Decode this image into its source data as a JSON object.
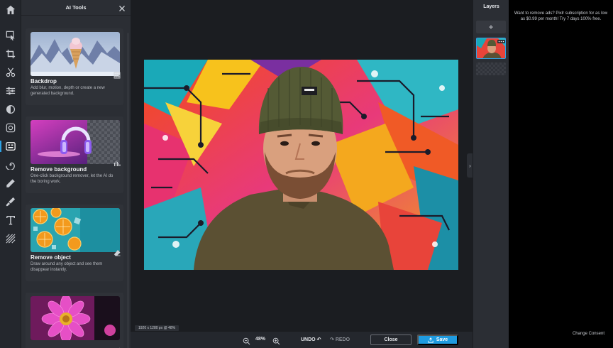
{
  "toolbar": {
    "home_icon": "home-icon",
    "tools": [
      "arrange-icon",
      "crop-icon",
      "cut-icon",
      "adjust-icon",
      "filter-icon",
      "effect-icon",
      "ai-tools-icon",
      "liquify-icon",
      "draw-icon",
      "retouch-icon",
      "text-icon",
      "pattern-icon"
    ],
    "active": "ai-tools-icon"
  },
  "panel": {
    "title": "AI Tools",
    "cards": [
      {
        "title": "Backdrop",
        "desc": "Add blur, motion, depth or create a new generated background.",
        "icon": "grid-icon"
      },
      {
        "title": "Remove background",
        "desc": "One-click background remover, let the AI do the boring work.",
        "icon": "magic-wand-icon"
      },
      {
        "title": "Remove object",
        "desc": "Draw around any object and see them disappear instantly.",
        "icon": "eraser-icon"
      },
      {
        "title": "",
        "desc": "",
        "icon": "brush-icon"
      }
    ]
  },
  "canvas": {
    "size_label": "1920 x 1280 px @ 48%"
  },
  "bottombar": {
    "zoom": "48%",
    "undo": "UNDO",
    "redo": "REDO",
    "close": "Close",
    "save": "Save"
  },
  "layers": {
    "title": "Layers",
    "add": "+"
  },
  "ad": {
    "text": "Want to remove ads? Pixlr subscription for as low as $0.99 per month! Try 7 days 100% free.",
    "consent": "Change Consent"
  },
  "colors": {
    "accent": "#1f9be0",
    "panel": "#2b2e34",
    "canvas": "#1b1d21"
  }
}
